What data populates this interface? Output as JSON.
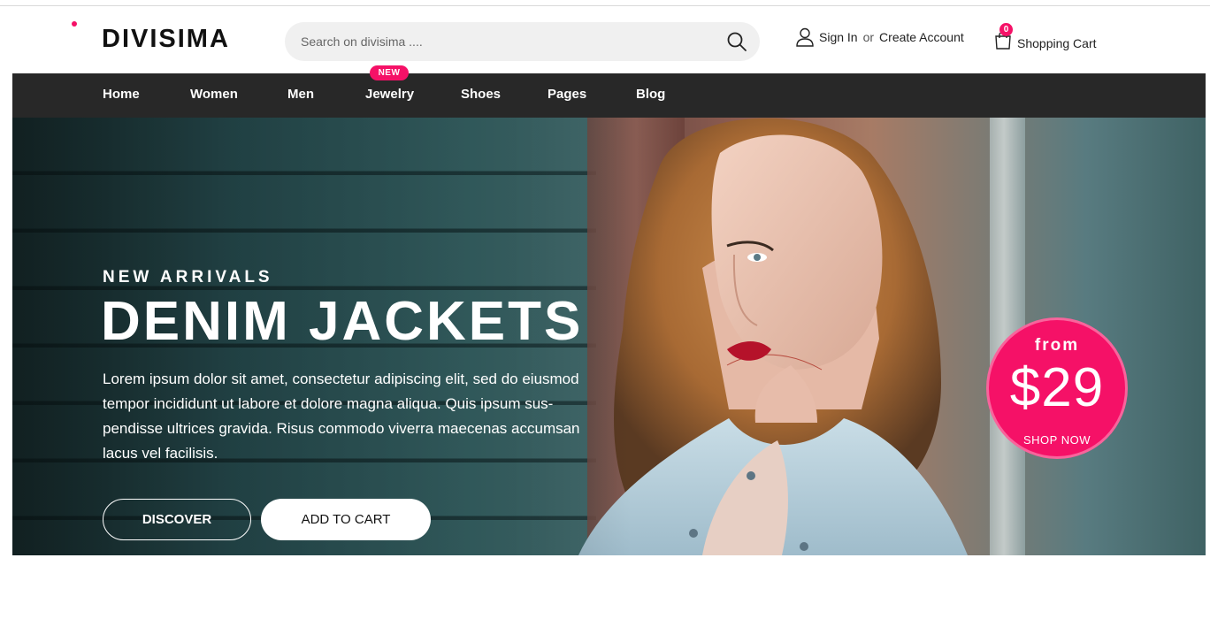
{
  "header": {
    "logo": "DIVISIMA",
    "search_placeholder": "Search on divisima ....",
    "sign_in": "Sign In",
    "or": "or",
    "create_account": "Create Account",
    "cart_count": "0",
    "cart_label": "Shopping Cart"
  },
  "nav": {
    "items": [
      "Home",
      "Women",
      "Men",
      "Jewelry",
      "Shoes",
      "Pages",
      "Blog"
    ],
    "badge": "NEW"
  },
  "hero": {
    "subtitle": "NEW ARRIVALS",
    "title": "DENIM JACKETS",
    "text": "Lorem ipsum dolor sit amet, consectetur adipiscing elit, sed do eiusmod tempor incididunt ut labore et dolore magna aliqua. Quis ipsum sus-pendisse ultrices gravida. Risus commodo viverra maecenas accumsan lacus vel facilisis.",
    "discover": "DISCOVER",
    "add_to_cart": "ADD TO CART",
    "price_from": "from",
    "price": "$29",
    "shop_now": "SHOP NOW"
  },
  "colors": {
    "accent": "#f51167",
    "nav_bg": "#282828"
  }
}
